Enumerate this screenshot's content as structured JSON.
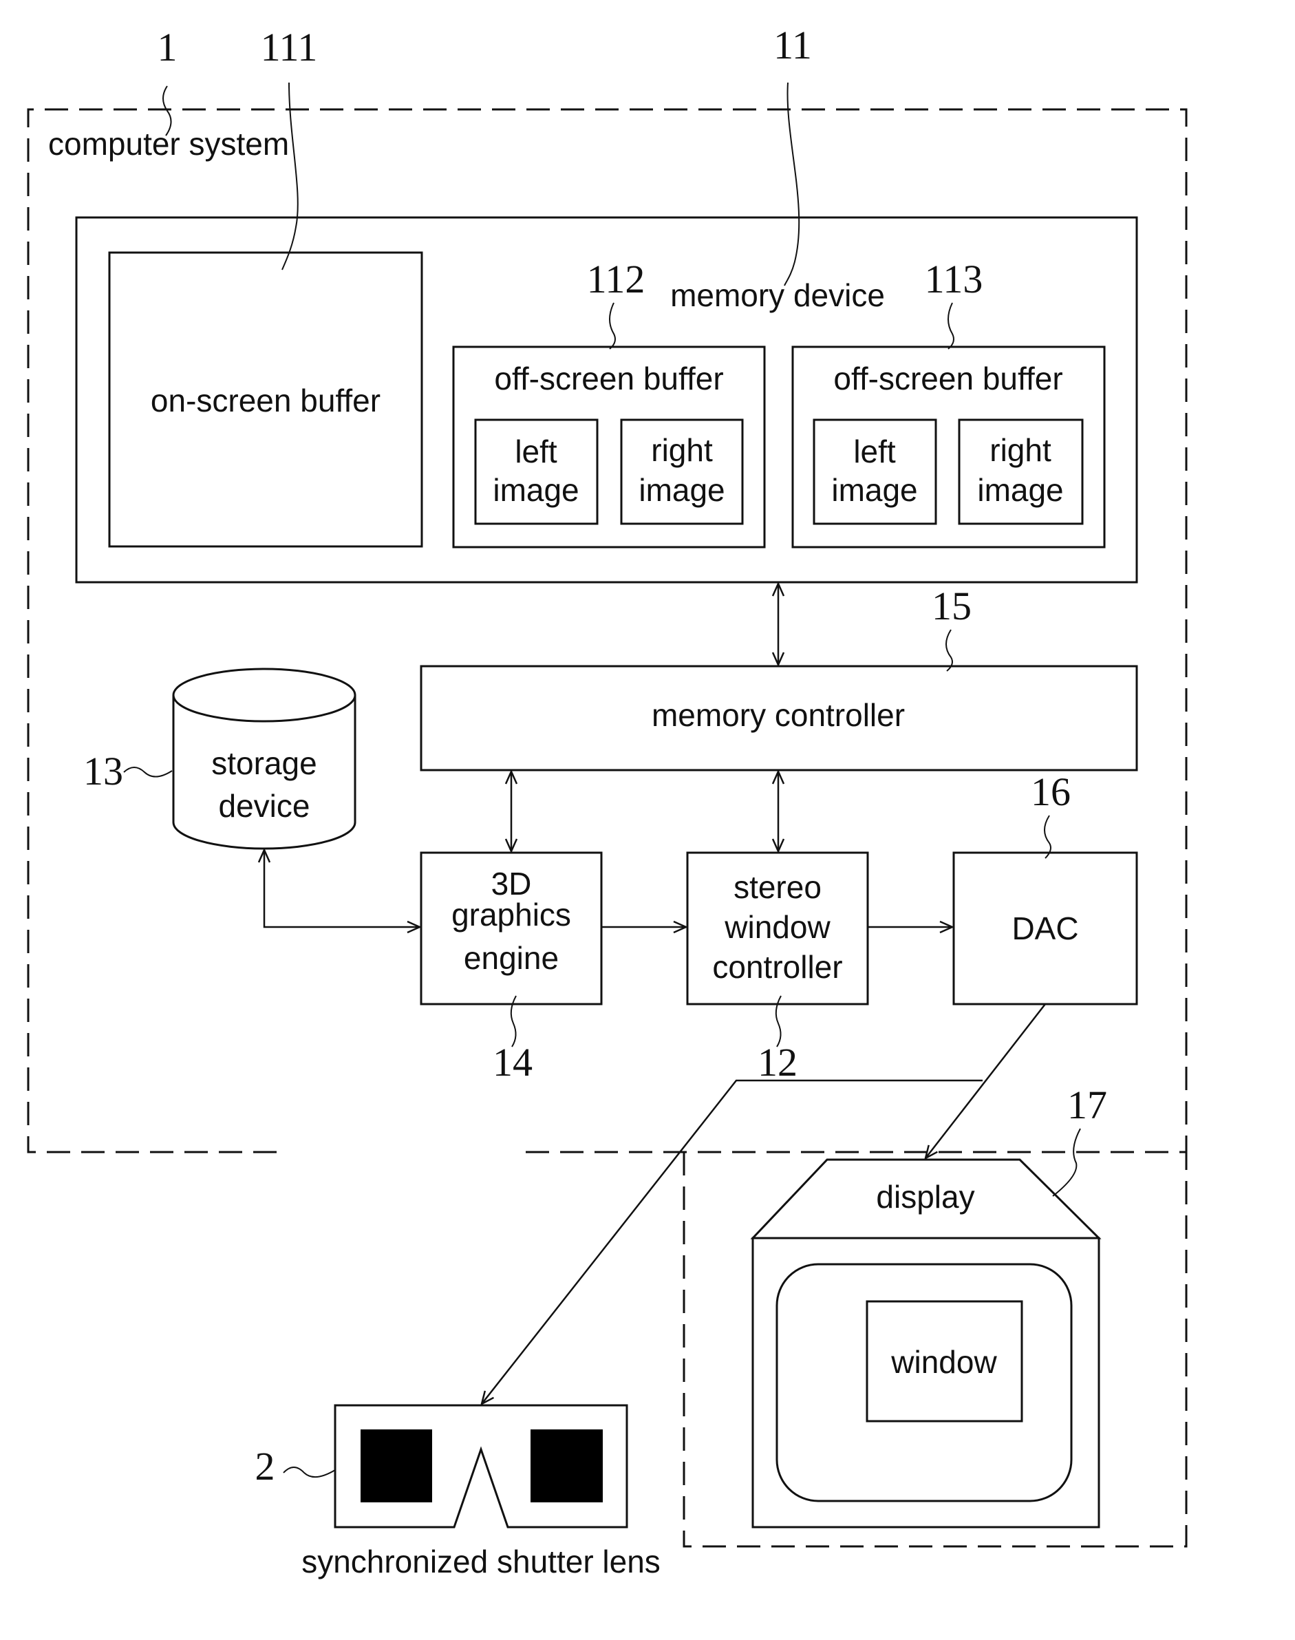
{
  "diagram": {
    "type": "block-diagram",
    "colors": {
      "line": "#111111",
      "background": "#ffffff",
      "lens_fill": "#000000"
    },
    "ref_numbers": {
      "computer_system": "1",
      "on_screen_buffer": "111",
      "memory_device": "11",
      "off_screen_buffer_a": "112",
      "off_screen_buffer_b": "113",
      "memory_controller": "15",
      "storage_device": "13",
      "dac": "16",
      "graphics_engine": "14",
      "stereo_window_controller": "12",
      "display": "17",
      "shutter_lens": "2"
    },
    "labels": {
      "computer_system": "computer system",
      "memory_device": "memory device",
      "on_screen_buffer": "on-screen buffer",
      "off_screen_buffer": "off-screen buffer",
      "left_image": [
        "left",
        "image"
      ],
      "right_image": [
        "right",
        "image"
      ],
      "memory_controller": "memory controller",
      "storage_device": [
        "storage",
        "device"
      ],
      "graphics_engine": [
        "3D",
        "graphics",
        "engine"
      ],
      "stereo_window_controller": [
        "stereo",
        "window",
        "controller"
      ],
      "dac": "DAC",
      "display": "display",
      "window": "window",
      "shutter_lens": "synchronized shutter lens"
    },
    "connections": [
      {
        "from": "memory device",
        "to": "memory controller",
        "direction": "bidirectional"
      },
      {
        "from": "memory controller",
        "to": "3D graphics engine",
        "direction": "bidirectional"
      },
      {
        "from": "memory controller",
        "to": "stereo window controller",
        "direction": "bidirectional"
      },
      {
        "from": "storage device",
        "to": "3D graphics engine",
        "direction": "bidirectional"
      },
      {
        "from": "3D graphics engine",
        "to": "stereo window controller",
        "direction": "forward"
      },
      {
        "from": "stereo window controller",
        "to": "DAC",
        "direction": "forward"
      },
      {
        "from": "DAC",
        "to": "display",
        "direction": "forward"
      },
      {
        "from": "DAC",
        "to": "synchronized shutter lens",
        "direction": "forward"
      }
    ]
  }
}
